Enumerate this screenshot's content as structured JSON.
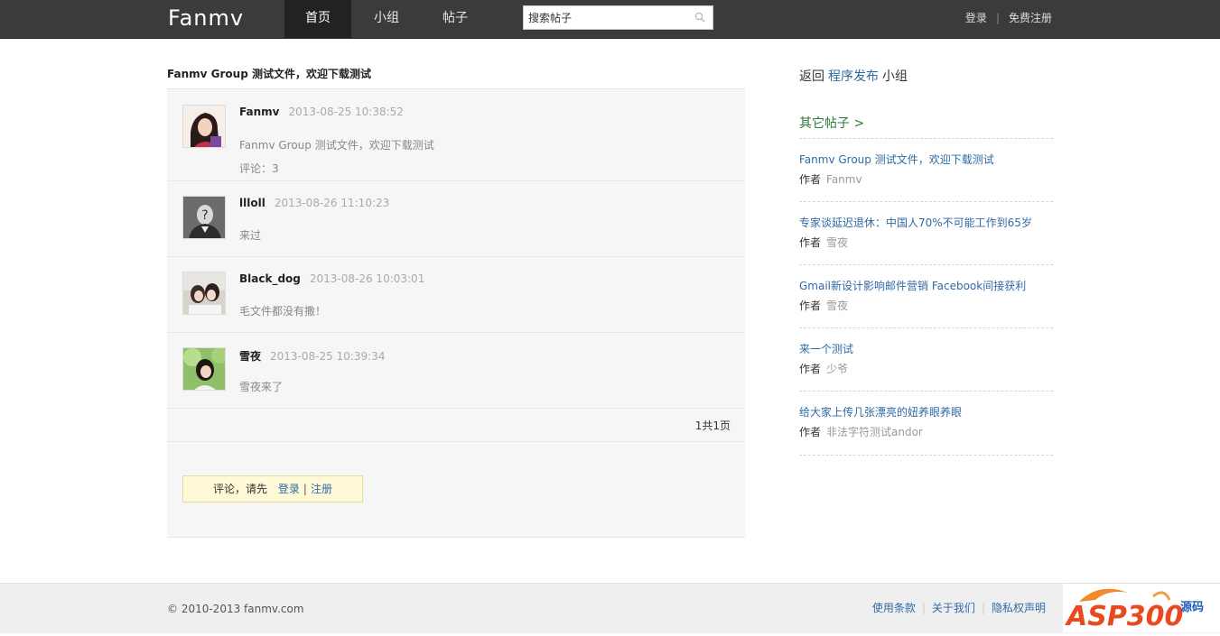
{
  "header": {
    "logo": "Fanmv",
    "nav": [
      {
        "label": "首页",
        "active": true
      },
      {
        "label": "小组",
        "active": false
      },
      {
        "label": "帖子",
        "active": false
      }
    ],
    "search_value": "搜索帖子",
    "login": "登录",
    "separator": "|",
    "register": "免费注册"
  },
  "post": {
    "title": "Fanmv Group 测试文件，欢迎下载测试",
    "replies": [
      {
        "author": "Fanmv",
        "time": "2013-08-25 10:38:52",
        "body": "Fanmv  Group  测试文件，欢迎下载测试",
        "meta": "评论：3"
      },
      {
        "author": "llloll",
        "time": "2013-08-26 11:10:23",
        "body": "来过",
        "meta": ""
      },
      {
        "author": "Black_dog",
        "time": "2013-08-26 10:03:01",
        "body": "毛文件都没有撒！",
        "meta": ""
      },
      {
        "author": "雪夜",
        "time": "2013-08-25 10:39:34",
        "body": "雪夜来了",
        "meta": ""
      }
    ],
    "pager": "1共1页",
    "comment_prompt": "评论，请先",
    "comment_login": "登录",
    "comment_sep": "|",
    "comment_register": "注册"
  },
  "sidebar": {
    "back_prefix": "返回",
    "back_group": "程序发布",
    "back_suffix": "小组",
    "other_title": "其它帖子 >",
    "author_label": "作者",
    "items": [
      {
        "title": "Fanmv Group 测试文件，欢迎下载测试",
        "author": "Fanmv"
      },
      {
        "title": "专家谈延迟退休：中国人70%不可能工作到65岁",
        "author": "雪夜"
      },
      {
        "title": "Gmail新设计影响邮件营销 Facebook间接获利",
        "author": "雪夜"
      },
      {
        "title": "来一个测试",
        "author": "少爷"
      },
      {
        "title": "给大家上传几张漂亮的妞养眼养眼",
        "author": "非法字符测试andor"
      }
    ]
  },
  "footer": {
    "copyright": "© 2010-2013 fanmv.com",
    "links": [
      "使用条款",
      "关于我们",
      "隐私权声明"
    ],
    "watermark": "ASP300源码"
  },
  "colors": {
    "topbar": "#3b3b3b",
    "nav_active": "#222222",
    "link": "#2f6aa5",
    "other_title": "#2c7a3a",
    "comment_box": "#fff9d7"
  }
}
